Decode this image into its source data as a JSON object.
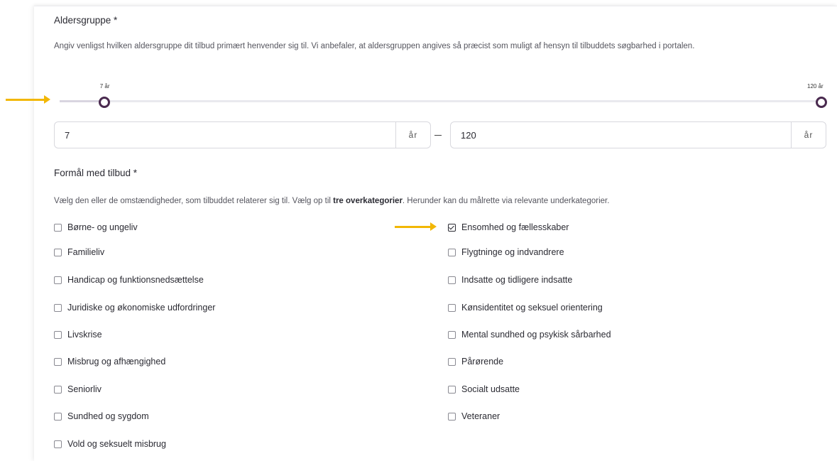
{
  "age_group": {
    "title": "Aldersgruppe *",
    "help": "Angiv venligst hvilken aldersgruppe dit tilbud primært henvender sig til. Vi anbefaler, at aldersgruppen angives så præcist som muligt af hensyn til tilbuddets søgbarhed i portalen.",
    "slider": {
      "min_label": "7 år",
      "max_label": "120 år",
      "min_value": 7,
      "max_value": 120,
      "range": [
        0,
        120
      ]
    },
    "from_input": {
      "value": "7",
      "unit": "år"
    },
    "to_input": {
      "value": "120",
      "unit": "år"
    }
  },
  "purpose": {
    "title": "Formål med tilbud *",
    "help_prefix": "Vælg den eller de omstændigheder, som tilbuddet relaterer sig til. Vælg op til ",
    "help_bold": "tre overkategorier",
    "help_suffix": ". Herunder kan du målrette via relevante underkategorier.",
    "left_options": [
      {
        "label": "Børne- og ungeliv",
        "checked": false
      },
      {
        "label": "Familieliv",
        "checked": false
      },
      {
        "label": "Handicap og funktionsnedsættelse",
        "checked": false
      },
      {
        "label": "Juridiske og økonomiske udfordringer",
        "checked": false
      },
      {
        "label": "Livskrise",
        "checked": false
      },
      {
        "label": "Misbrug og afhængighed",
        "checked": false
      },
      {
        "label": "Seniorliv",
        "checked": false
      },
      {
        "label": "Sundhed og sygdom",
        "checked": false
      },
      {
        "label": "Vold og seksuelt misbrug",
        "checked": false
      }
    ],
    "right_options": [
      {
        "label": "Ensomhed og fællesskaber",
        "checked": true
      },
      {
        "label": "Flygtninge og indvandrere",
        "checked": false
      },
      {
        "label": "Indsatte og tidligere indsatte",
        "checked": false
      },
      {
        "label": "Kønsidentitet og seksuel orientering",
        "checked": false
      },
      {
        "label": "Mental sundhed og psykisk sårbarhed",
        "checked": false
      },
      {
        "label": "Pårørende",
        "checked": false
      },
      {
        "label": "Socialt udsatte",
        "checked": false
      },
      {
        "label": "Veteraner",
        "checked": false
      }
    ]
  },
  "colors": {
    "accent": "#4a2a4f",
    "annotation_arrow": "#f2b705"
  }
}
